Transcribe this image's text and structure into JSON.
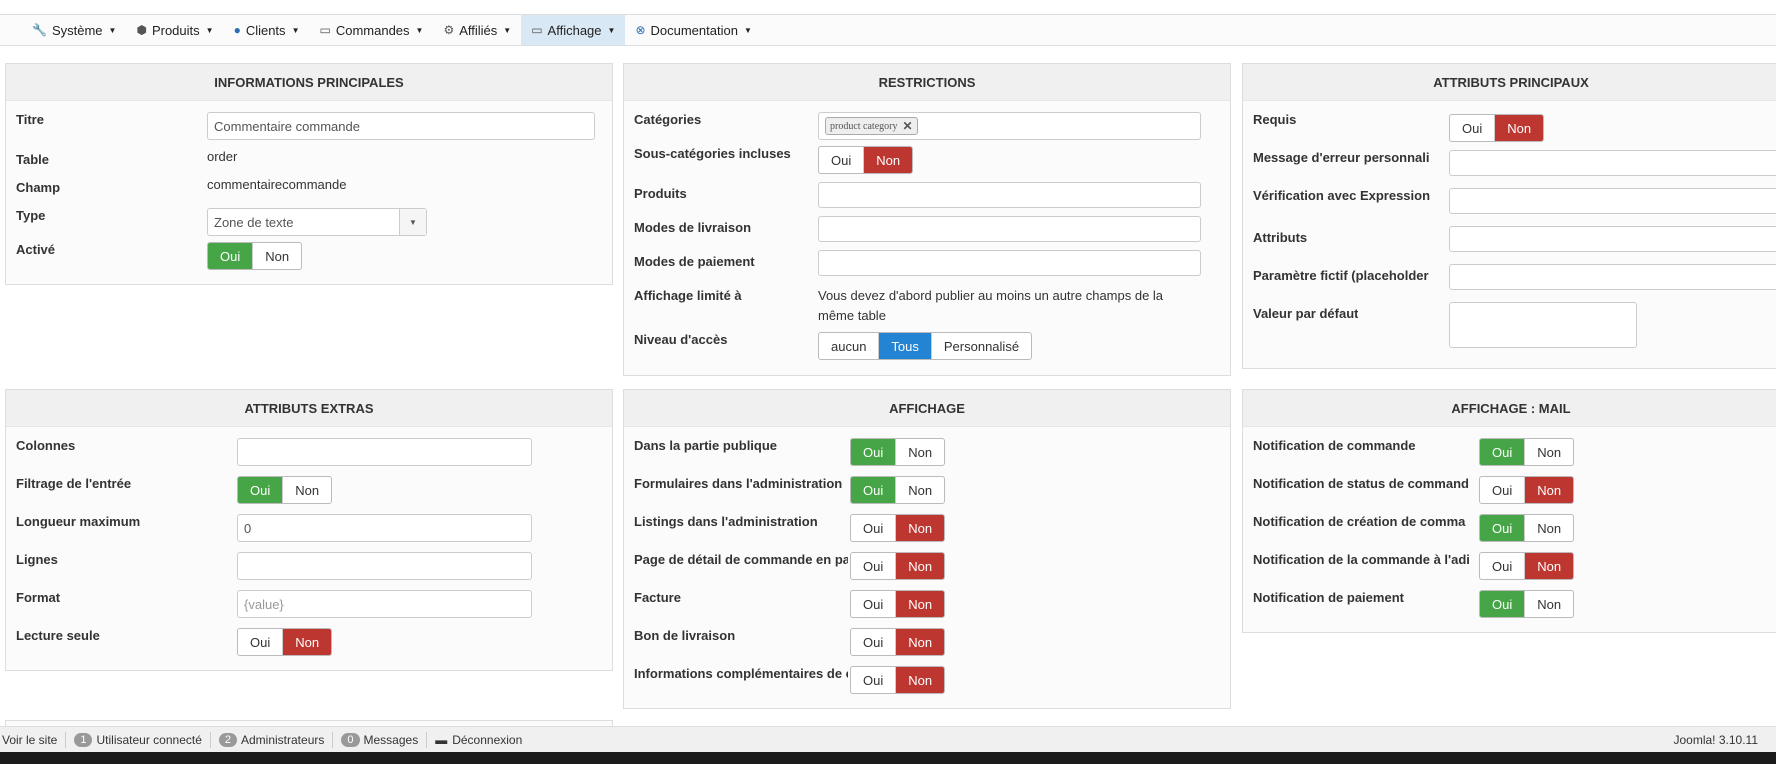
{
  "nav": [
    {
      "label": "Système",
      "icon": "wrench-icon"
    },
    {
      "label": "Produits",
      "icon": "cubes-icon"
    },
    {
      "label": "Clients",
      "icon": "user-icon"
    },
    {
      "label": "Commandes",
      "icon": "credit-card-icon"
    },
    {
      "label": "Affiliés",
      "icon": "affiliates-icon"
    },
    {
      "label": "Affichage",
      "icon": "monitor-icon",
      "active": true
    },
    {
      "label": "Documentation",
      "icon": "lifebuoy-icon"
    }
  ],
  "info": {
    "title": "INFORMATIONS PRINCIPALES",
    "titre_label": "Titre",
    "titre_value": "Commentaire commande",
    "table_label": "Table",
    "table_value": "order",
    "champ_label": "Champ",
    "champ_value": "commentairecommande",
    "type_label": "Type",
    "type_value": "Zone de texte",
    "active_label": "Activé",
    "oui": "Oui",
    "non": "Non"
  },
  "restr": {
    "title": "RESTRICTIONS",
    "cat_label": "Catégories",
    "cat_tag": "product category",
    "souscat_label": "Sous-catégories incluses",
    "prod_label": "Produits",
    "livr_label": "Modes de livraison",
    "paie_label": "Modes de paiement",
    "aff_label": "Affichage limité à",
    "aff_text": "Vous devez d'abord publier au moins un autre champs de la même table",
    "acces_label": "Niveau d'accès",
    "acces_opts": [
      "aucun",
      "Tous",
      "Personnalisé"
    ],
    "oui": "Oui",
    "non": "Non"
  },
  "attr": {
    "title": "ATTRIBUTS PRINCIPAUX",
    "requis_label": "Requis",
    "err_label": "Message d'erreur personnali",
    "regex_label": "Vérification avec Expression",
    "attributs_label": "Attributs",
    "placeholder_label": "Paramètre fictif (placeholder",
    "default_label": "Valeur par défaut",
    "oui": "Oui",
    "non": "Non"
  },
  "extras": {
    "title": "ATTRIBUTS EXTRAS",
    "colonnes_label": "Colonnes",
    "filtrage_label": "Filtrage de l'entrée",
    "longueur_label": "Longueur maximum",
    "longueur_value": "0",
    "lignes_label": "Lignes",
    "format_label": "Format",
    "format_placeholder": "{value}",
    "lecture_label": "Lecture seule",
    "oui": "Oui",
    "non": "Non"
  },
  "affichage": {
    "title": "AFFICHAGE",
    "rows": [
      "Dans la partie publique",
      "Formulaires dans l'administration",
      "Listings dans l'administration",
      "Page de détail de commande en pa",
      "Facture",
      "Bon de livraison",
      "Informations complémentaires de c"
    ],
    "oui": "Oui",
    "non": "Non"
  },
  "mail": {
    "title": "AFFICHAGE : MAIL",
    "rows": [
      "Notification de commande",
      "Notification de status de command",
      "Notification de création de comma",
      "Notification de la commande à l'adi",
      "Notification de paiement"
    ],
    "oui": "Oui",
    "non": "Non"
  },
  "status": {
    "voir": "Voir le site",
    "users_count": "1",
    "users_label": "Utilisateur connecté",
    "admins_count": "2",
    "admins_label": "Administrateurs",
    "msg_count": "0",
    "msg_label": "Messages",
    "logout": "Déconnexion",
    "version": "Joomla! 3.10.11"
  }
}
